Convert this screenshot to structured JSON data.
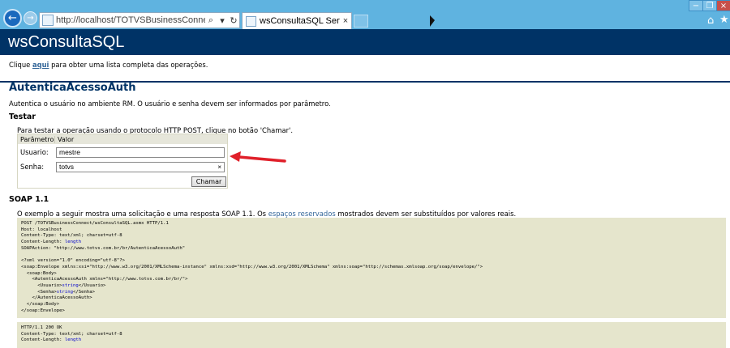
{
  "browser": {
    "url": "http://localhost/TOTVSBusinessConnect/wsConsultaS",
    "tab_title": "wsConsultaSQL Serviço da ...",
    "tab_close": "×",
    "addr_search": "⌕",
    "addr_dropdown": "▾",
    "addr_refresh": "↻",
    "window_minimize": "−",
    "window_restore": "❐",
    "window_close": "×",
    "home_icon": "⌂",
    "favorites_icon": "★",
    "back_icon": "←",
    "forward_icon": "→"
  },
  "page": {
    "service_name": "wsConsultaSQL",
    "intro_before": "Clique ",
    "intro_link": "aqui",
    "intro_after": " para obter uma lista completa das operações.",
    "operation_title": "AutenticaAcessoAuth",
    "operation_desc": "Autentica o usuário no ambiente RM. O usuário e senha devem ser informados por parâmetro.",
    "test_heading": "Testar",
    "test_desc": "Para testar a operação usando o protocolo HTTP POST, clique no botão 'Chamar'.",
    "form": {
      "col_param": "Parâmetro",
      "col_value": "Valor",
      "usuario_label": "Usuario:",
      "usuario_value": "mestre",
      "senha_label": "Senha:",
      "senha_value": "totvs",
      "clear_icon": "×",
      "submit_label": "Chamar"
    },
    "soap_heading": "SOAP 1.1",
    "soap_desc_before": "O exemplo a seguir mostra uma solicitação e uma resposta SOAP 1.1. Os ",
    "soap_desc_link": "espaços reservados",
    "soap_desc_after": " mostrados devem ser substituídos por valores reais.",
    "request_code": {
      "line1": "POST /TOTVSBusinessConnect/wsConsultaSQL.asmx HTTP/1.1",
      "line2": "Host: localhost",
      "line3": "Content-Type: text/xml; charset=utf-8",
      "line4_prefix": "Content-Length: ",
      "line4_ph": "length",
      "line5": "SOAPAction: \"http://www.totvs.com.br/br/AutenticaAcessoAuth\"",
      "line6": "<?xml version=\"1.0\" encoding=\"utf-8\"?>",
      "line7": "<soap:Envelope xmlns:xsi=\"http://www.w3.org/2001/XMLSchema-instance\" xmlns:xsd=\"http://www.w3.org/2001/XMLSchema\" xmlns:soap=\"http://schemas.xmlsoap.org/soap/envelope/\">",
      "line8": "  <soap:Body>",
      "line9": "    <AutenticaAcessoAuth xmlns=\"http://www.totvs.com.br/br/\">",
      "line10_prefix": "      <Usuario>",
      "line10_ph": "string",
      "line10_suffix": "</Usuario>",
      "line11_prefix": "      <Senha>",
      "line11_ph": "string",
      "line11_suffix": "</Senha>",
      "line12": "    </AutenticaAcessoAuth>",
      "line13": "  </soap:Body>",
      "line14": "</soap:Envelope>"
    },
    "response_code": {
      "line1": "HTTP/1.1 200 OK",
      "line2": "Content-Type: text/xml; charset=utf-8",
      "line3_prefix": "Content-Length: ",
      "line3_ph": "length"
    }
  }
}
